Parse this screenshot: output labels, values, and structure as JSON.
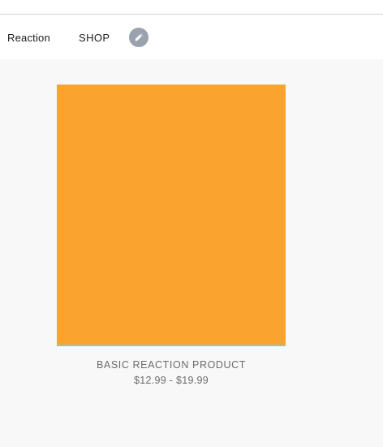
{
  "header": {
    "brand": "Reaction",
    "nav": {
      "shop_label": "SHOP"
    },
    "edit_button_icon": "pencil-icon"
  },
  "colors": {
    "product_placeholder": "#fba32f",
    "image_underline": "#8ec5d0",
    "edit_button_bg": "#9aa3ad",
    "page_background": "#f8f8f8"
  },
  "products": [
    {
      "title": "BASIC REACTION PRODUCT",
      "price": "$12.99 - $19.99"
    }
  ]
}
